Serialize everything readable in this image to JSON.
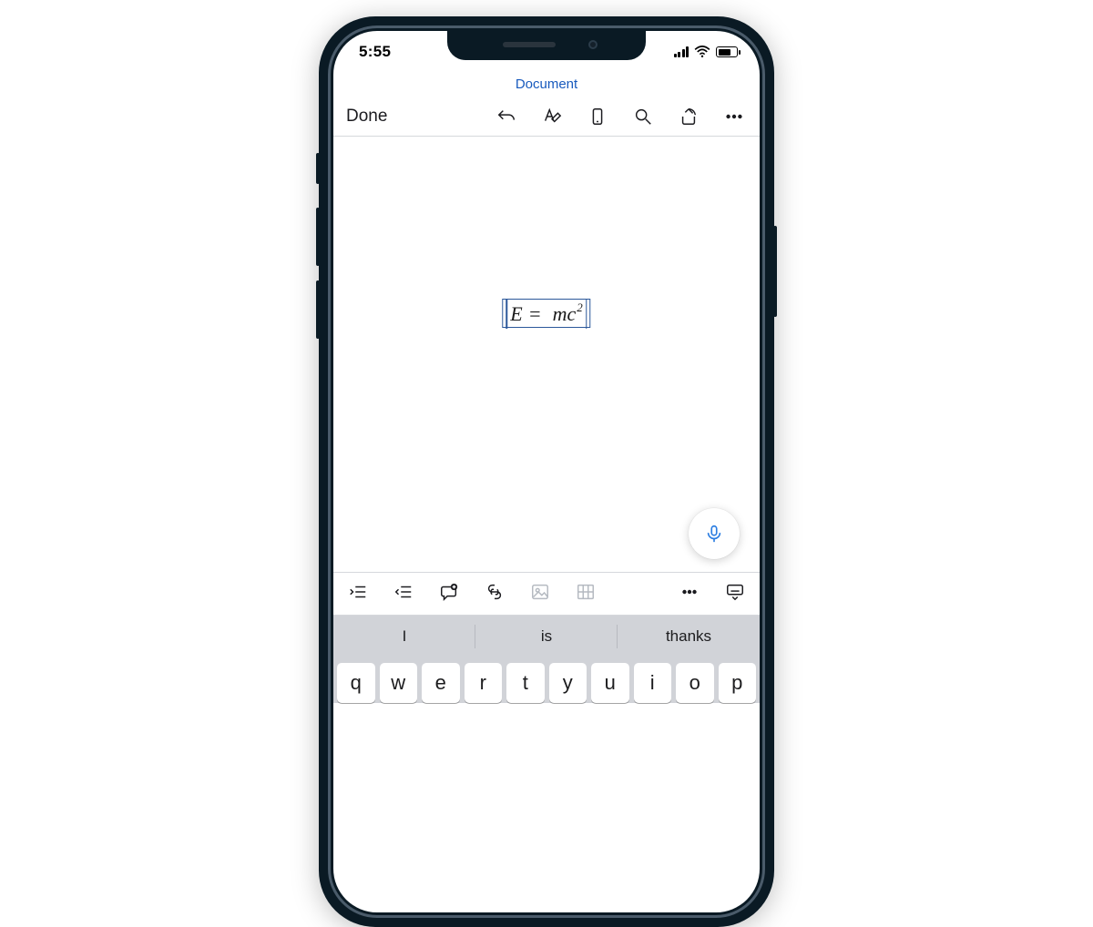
{
  "status": {
    "time": "5:55"
  },
  "header": {
    "title": "Document",
    "done_label": "Done"
  },
  "equation": {
    "lhs": "E",
    "op": "=",
    "rhs_base": "mc",
    "rhs_exp": "2"
  },
  "suggestions": [
    "I",
    "is",
    "thanks"
  ],
  "keyboard_row1": [
    "q",
    "w",
    "e",
    "r",
    "t",
    "y",
    "u",
    "i",
    "o",
    "p"
  ]
}
